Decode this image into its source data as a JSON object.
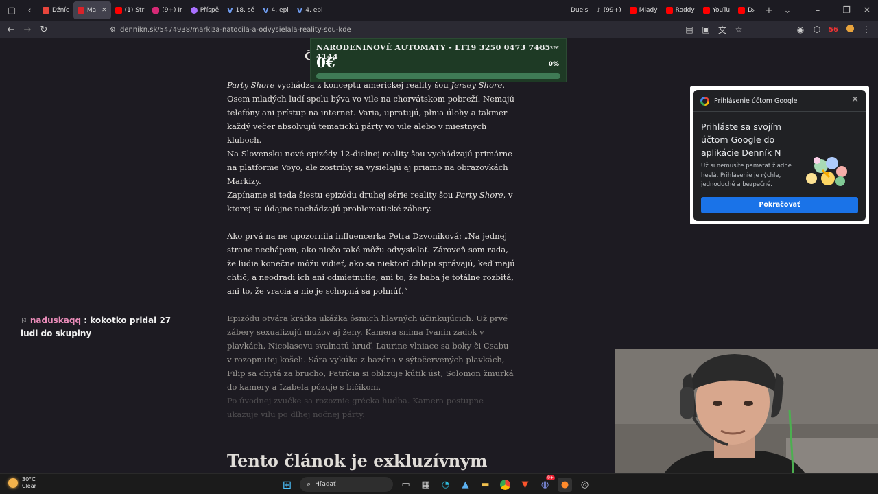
{
  "browser": {
    "tabs": [
      {
        "label": "Džníc",
        "color": "#e8453c"
      },
      {
        "label": "Ma",
        "color": "#d8232a",
        "active": true
      },
      {
        "label": "(1) Str",
        "color": "#ff0000"
      },
      {
        "label": "(9+) Ir",
        "color": "#d62976"
      },
      {
        "label": "Příspě",
        "color": "#a970ff"
      },
      {
        "label": "18. sé",
        "color": "#3b6fd9"
      },
      {
        "label": "4. epi",
        "color": "#3b6fd9"
      },
      {
        "label": "4. epi",
        "color": "#3b6fd9"
      }
    ],
    "right_tabs": [
      {
        "label": "Duels",
        "color": "#3a3a3a"
      },
      {
        "label": "(99+)",
        "color": "#ffffff"
      },
      {
        "label": "Mladý",
        "color": "#ff0000"
      },
      {
        "label": "Roddy",
        "color": "#ff0000"
      },
      {
        "label": "YouTu",
        "color": "#ff0000"
      },
      {
        "label": "D",
        "color": "#ff0000"
      }
    ],
    "url": "dennikn.sk/5474938/markiza-natocila-a-odvysielala-reality-sou-kde",
    "ext_badge": "56"
  },
  "stream_overlay": {
    "title": "NARODENINOVÉ AUTOMATY - LT19 3250 0473 7485 4144",
    "goal": "0€ / 132€",
    "amount": "0€",
    "percent_label": "0%",
    "progress": 0
  },
  "article": {
    "heading": "Čo odvysielala Markíza",
    "p1_a": "Party Shore",
    "p1_b": " vychádza z konceptu americkej reality šou ",
    "p1_c": "Jersey Shore",
    "p1_d": ". Osem mladých ľudí spolu býva vo vile na chorvátskom pobreží. Nemajú telefóny ani prístup na internet. Varia, upratujú, plnia úlohy a takmer každý večer absolvujú tematickú párty vo vile alebo v miestnych kluboch.",
    "p2": "Na Slovensku nové epizódy 12-dielnej reality šou vychádzajú primárne na platforme Voyo, ale zostrihy sa vysielajú aj priamo na obrazovkách Markízy.",
    "p3_a": "Zapíname si teda šiestu epizódu druhej série reality šou ",
    "p3_b": "Party Shore",
    "p3_c": ", v ktorej sa údajne nachádzajú problematické zábery.",
    "p4": "Ako prvá na ne upozornila influencerka Petra Dzvoníková: „Na jednej strane nechápem, ako niečo také môžu odvysielať. Zároveň som rada, že ľudia konečne môžu vidieť, ako sa niektorí chlapi správajú, keď majú chtíč, a neodradí ich ani odmietnutie, ani to, že baba je totálne rozbitá, ani to, že vracia a nie je schopná sa pohnúť.“",
    "p5": "Epizódu otvára krátka ukážka ôsmich hlavných účinkujúcich. Už prvé zábery sexualizujú mužov aj ženy. Kamera sníma Ivanin zadok v plavkách, Nicolasovu svalnatú hruď, Laurine vlniace sa boky či Csabu v rozopnutej košeli. Sára vykúka z bazéna v sýtočervených plavkách, Filip sa chytá za brucho, Patrícia si oblizuje kútik úst, Solomon žmurká do kamery a Izabela pózuje s bičíkom.",
    "p6": "Po úvodnej zvučke sa rozoznie grécka hudba. Kamera postupne ukazuje vilu po dlhej nočnej párty.",
    "paywall_heading": "Tento článok je exkluzívnym"
  },
  "google_popup": {
    "header": "Prihlásenie účtom Google",
    "title": "Prihláste sa svojím účtom Google do aplikácie Denník N",
    "body": "Už si nemusíte pamätať žiadne heslá. Prihlásenie je rýchle, jednoduché a bezpečné.",
    "button": "Pokračovať"
  },
  "chat": {
    "username": "naduskaqq",
    "message": " : kokotko pridal 27 ludi do skupiny"
  },
  "taskbar": {
    "temp": "30°C",
    "condition": "Clear",
    "search_placeholder": "Hľadať",
    "discord_badge": "9+"
  }
}
